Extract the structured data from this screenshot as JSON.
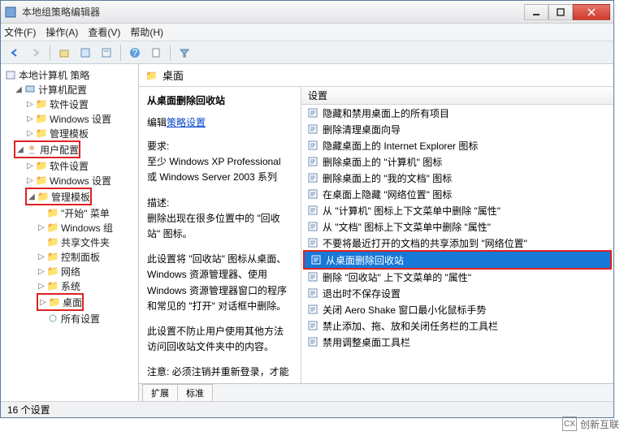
{
  "window": {
    "title": "本地组策略编辑器"
  },
  "menus": {
    "file": "文件(F)",
    "action": "操作(A)",
    "view": "查看(V)",
    "help": "帮助(H)"
  },
  "tree": {
    "root": "本地计算机 策略",
    "computer_config": "计算机配置",
    "cc_software": "软件设置",
    "cc_windows": "Windows 设置",
    "cc_templates": "管理模板",
    "user_config": "用户配置",
    "uc_software": "软件设置",
    "uc_windows": "Windows 设置",
    "uc_templates": "管理模板",
    "start_menu": "\"开始\" 菜单",
    "windows_group": "Windows 组",
    "shared_folders": "共享文件夹",
    "control_panel": "控制面板",
    "network": "网络",
    "system": "系统",
    "desktop": "桌面",
    "all_settings": "所有设置"
  },
  "right": {
    "header": "桌面",
    "desc_title": "从桌面删除回收站",
    "edit_prefix": "编辑",
    "edit_link": "策略设置",
    "req_label": "要求:",
    "req_text": "至少 Windows XP Professional 或 Windows Server 2003 系列",
    "desc_label": "描述:",
    "desc_text1": "删除出现在很多位置中的 \"回收站\" 图标。",
    "desc_text2": "此设置将 \"回收站\" 图标从桌面、Windows 资源管理器、使用Windows 资源管理器窗口的程序和常见的 \"打开\" 对话框中删除。",
    "desc_text3": "此设置不防止用户使用其他方法访问回收站文件夹中的内容。",
    "desc_text4": "注意: 必须注销并重新登录，才能",
    "settings_header": "设置",
    "items": [
      "隐藏和禁用桌面上的所有项目",
      "删除清理桌面向导",
      "隐藏桌面上的 Internet Explorer 图标",
      "删除桌面上的 \"计算机\" 图标",
      "删除桌面上的 \"我的文档\" 图标",
      "在桌面上隐藏 \"网络位置\" 图标",
      "从 \"计算机\" 图标上下文菜单中删除 \"属性\"",
      "从 \"文档\" 图标上下文菜单中删除 \"属性\"",
      "不要将最近打开的文档的共享添加到 \"网络位置\"",
      "从桌面删除回收站",
      "删除 \"回收站\" 上下文菜单的 \"属性\"",
      "退出时不保存设置",
      "关闭 Aero Shake 窗口最小化鼠标手势",
      "禁止添加、拖、放和关闭任务栏的工具栏",
      "禁用调整桌面工具栏"
    ],
    "selected_index": 9,
    "tabs": {
      "extended": "扩展",
      "standard": "标准"
    }
  },
  "status": "16 个设置",
  "watermark": "创新互联"
}
